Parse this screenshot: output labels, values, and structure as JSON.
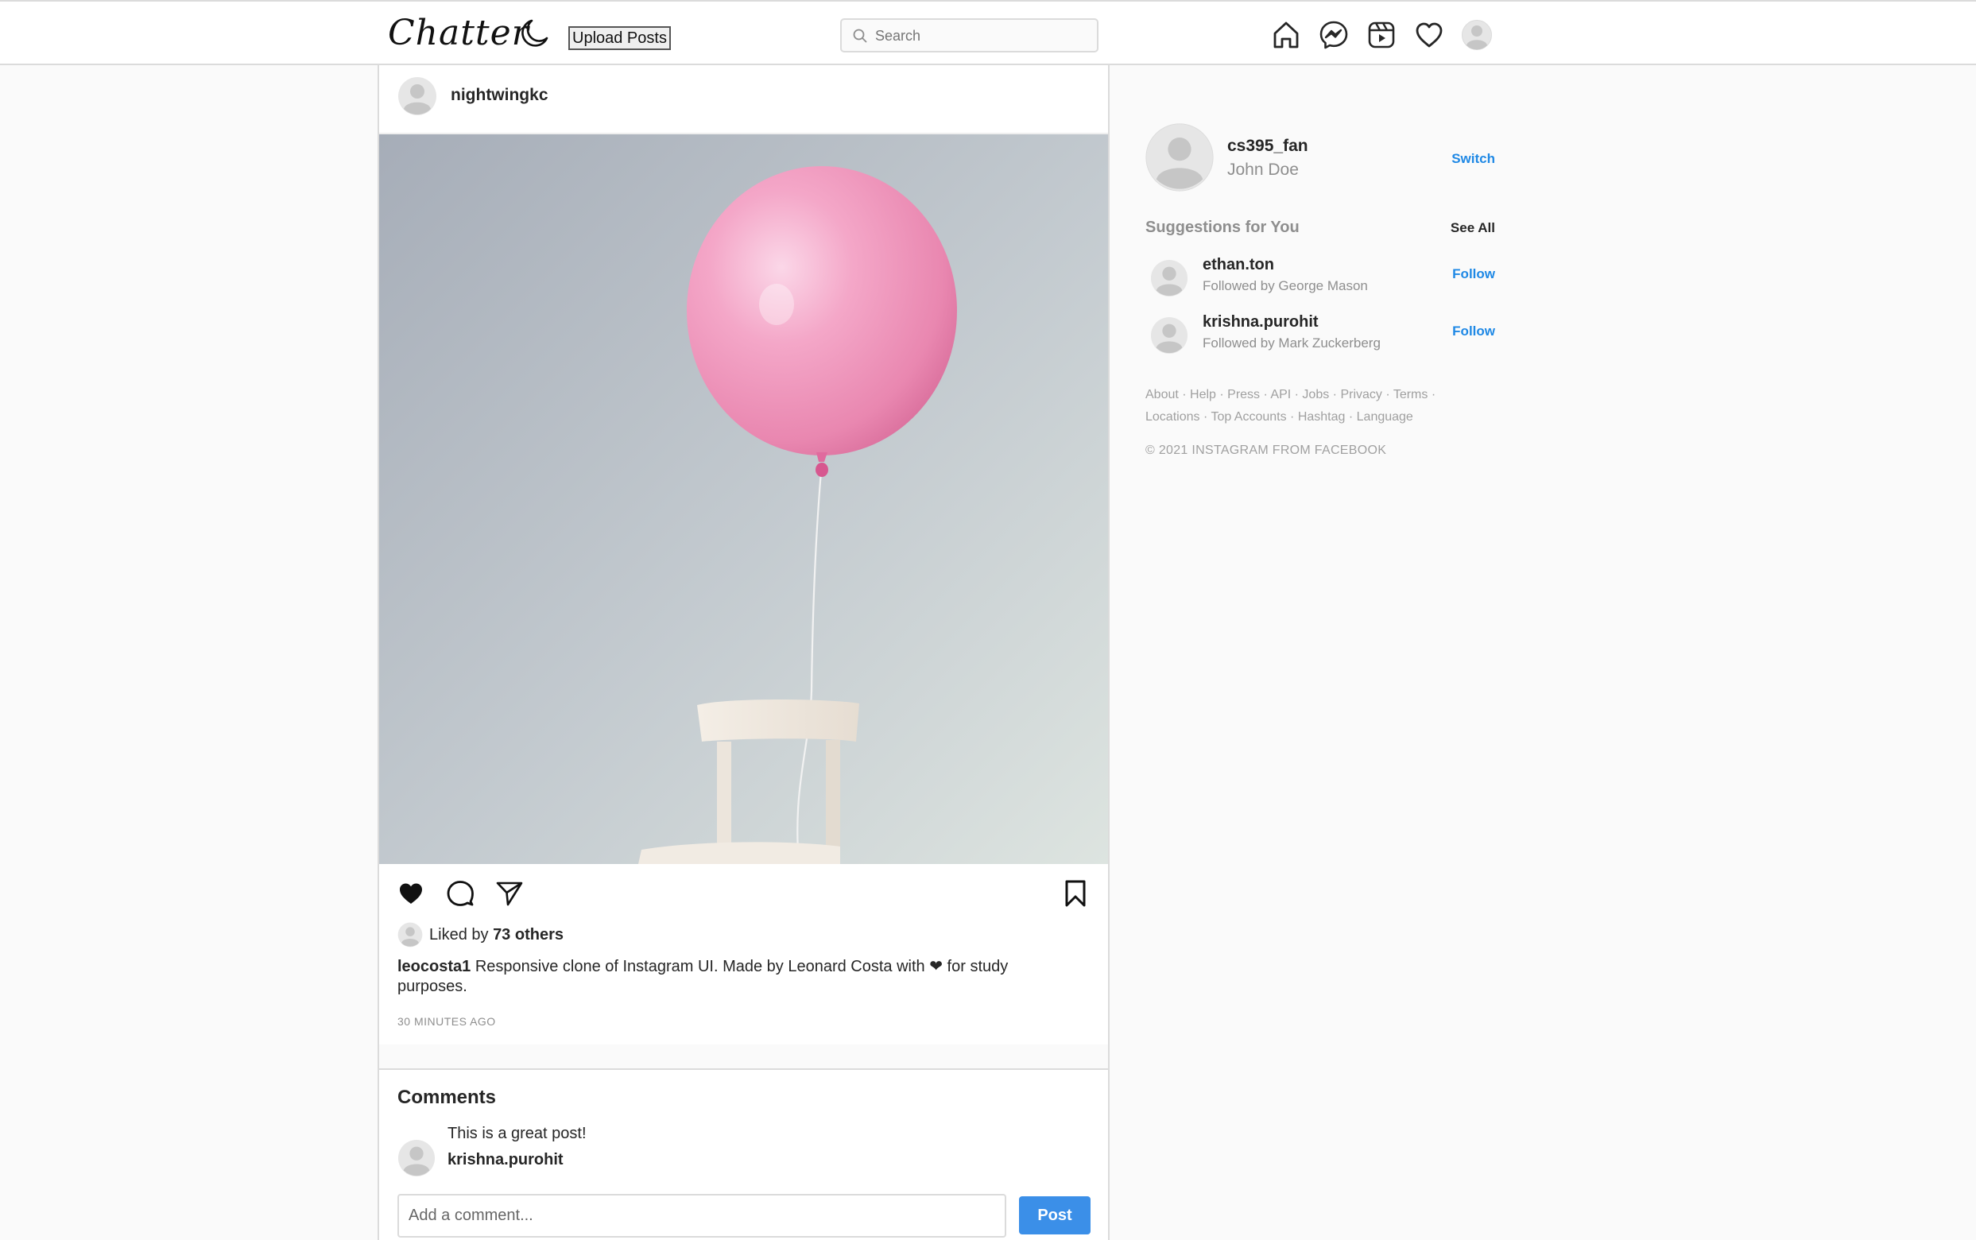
{
  "app": {
    "logo": "Chatter",
    "upload_label": "Upload Posts"
  },
  "search": {
    "placeholder": "Search"
  },
  "nav": {
    "icons": [
      "home-icon",
      "messenger-icon",
      "reels-icon",
      "heart-icon",
      "profile-avatar"
    ]
  },
  "post": {
    "author": "nightwingkc",
    "likes_prefix": "Liked by ",
    "likes_count": "73 others",
    "caption_user": "leocosta1",
    "caption_text": " Responsive clone of Instagram UI. Made by Leonard Costa with ❤ for study purposes.",
    "time": "30 MINUTES AGO",
    "comments_title": "Comments",
    "comments": [
      {
        "text": "This is a great post!",
        "user": "krishna.purohit"
      }
    ],
    "add_comment_placeholder": "Add a comment...",
    "post_button": "Post"
  },
  "sidebar": {
    "username": "cs395_fan",
    "fullname": "John Doe",
    "switch_label": "Switch",
    "suggestions_title": "Suggestions for You",
    "see_all": "See All",
    "suggestions": [
      {
        "username": "ethan.ton",
        "followed_by": "Followed by George Mason",
        "action": "Follow"
      },
      {
        "username": "krishna.purohit",
        "followed_by": "Followed by Mark Zuckerberg",
        "action": "Follow"
      }
    ],
    "footer_links": [
      "About",
      "Help",
      "Press",
      "API",
      "Jobs",
      "Privacy",
      "Terms",
      "Locations",
      "Top Accounts",
      "Hashtag",
      "Language"
    ],
    "copyright": "© 2021 INSTAGRAM FROM FACEBOOK"
  },
  "colors": {
    "accent": "#3b8fe8",
    "link": "#1e88e5",
    "muted": "#8e8e8e",
    "balloon": "#f4a0c4"
  }
}
